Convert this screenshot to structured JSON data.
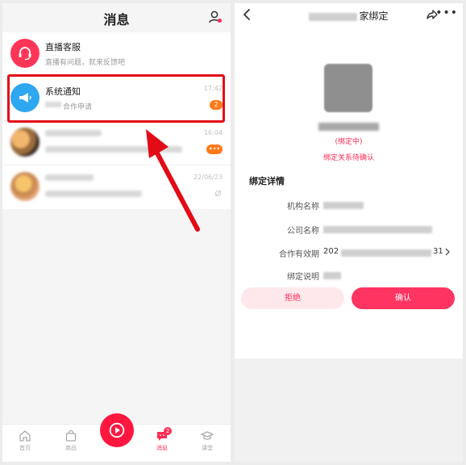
{
  "messages_screen": {
    "title": "消息",
    "list": [
      {
        "title": "直播客服",
        "subtitle": "直播有问题，就来反馈吧",
        "time": "",
        "badge": ""
      },
      {
        "title": "系统通知",
        "subtitle": "合作申请",
        "time": "17:42",
        "badge": "2"
      },
      {
        "title": "",
        "subtitle": "",
        "time": "16:04",
        "badge": "•••"
      },
      {
        "title": "",
        "subtitle": "",
        "time": "22/06/23",
        "badge": ""
      }
    ],
    "tabs": [
      {
        "label": "首页",
        "badge": ""
      },
      {
        "label": "商品",
        "badge": ""
      },
      {
        "label": "消息",
        "badge": "2"
      },
      {
        "label": "课堂",
        "badge": ""
      }
    ]
  },
  "binding_screen": {
    "title": "家绑定",
    "status": "(绑定中)",
    "pending_text": "绑定关系待确认",
    "section_title": "绑定详情",
    "fields": [
      {
        "label": "机构名称",
        "value_prefix": "",
        "value_suffix": ""
      },
      {
        "label": "公司名称",
        "value_prefix": "",
        "value_suffix": ""
      },
      {
        "label": "合作有效期",
        "value_prefix": "202",
        "value_suffix": "31"
      },
      {
        "label": "绑定说明",
        "value_prefix": "",
        "value_suffix": ""
      }
    ],
    "reject_label": "拒绝",
    "confirm_label": "确认"
  },
  "colors": {
    "brand_red": "#ff2d55",
    "highlight_red": "#e30b16",
    "notice_blue": "#2ea6f0",
    "badge_orange": "#ff7a1a"
  }
}
